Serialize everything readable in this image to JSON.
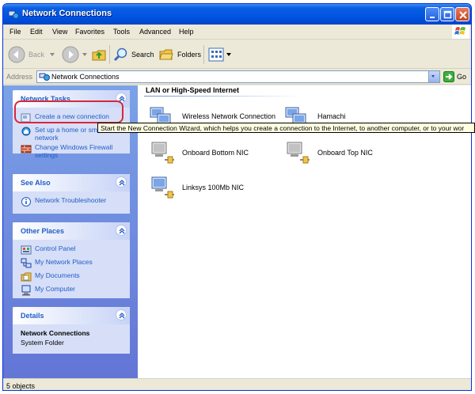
{
  "window": {
    "title": "Network Connections"
  },
  "menu": {
    "items": [
      "File",
      "Edit",
      "View",
      "Favorites",
      "Tools",
      "Advanced",
      "Help"
    ]
  },
  "toolbar": {
    "back": "Back",
    "search": "Search",
    "folders": "Folders"
  },
  "address": {
    "label": "Address",
    "value": "Network Connections",
    "go": "Go"
  },
  "tasks": {
    "network_tasks": {
      "title": "Network Tasks",
      "items": [
        "Create a new connection",
        "Set up a home or small office network",
        "Change Windows Firewall settings"
      ]
    },
    "see_also": {
      "title": "See Also",
      "items": [
        "Network Troubleshooter"
      ]
    },
    "other_places": {
      "title": "Other Places",
      "items": [
        "Control Panel",
        "My Network Places",
        "My Documents",
        "My Computer"
      ]
    },
    "details": {
      "title": "Details",
      "name": "Network Connections",
      "type": "System Folder"
    }
  },
  "tooltip": "Start the New Connection Wizard, which helps you create a connection to the Internet, to another computer, or to your wor",
  "content": {
    "group_title": "LAN or High-Speed Internet",
    "connections": [
      "Wireless Network Connection",
      "Hamachi",
      "Onboard Bottom NIC",
      "Onboard Top NIC",
      "Linksys 100Mb NIC"
    ]
  },
  "status": {
    "text": "5 objects"
  },
  "colors": {
    "titlebar": "#0054e3",
    "task_link": "#215dc6",
    "highlight": "#d8273a",
    "tooltip_bg": "#ffffe1"
  }
}
